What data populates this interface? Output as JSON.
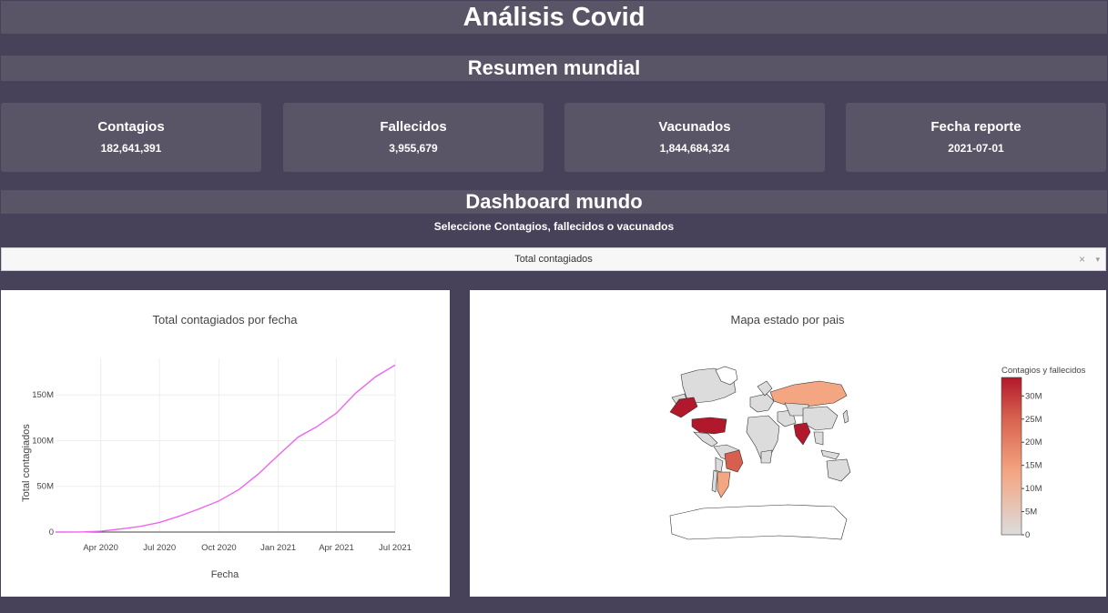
{
  "header": {
    "title": "Análisis Covid",
    "summary_title": "Resumen mundial",
    "dashboard_title": "Dashboard mundo",
    "select_prompt": "Seleccione Contagios, fallecidos o vacunados"
  },
  "cards": [
    {
      "label": "Contagios",
      "value": "182,641,391"
    },
    {
      "label": "Fallecidos",
      "value": "3,955,679"
    },
    {
      "label": "Vacunados",
      "value": "1,844,684,324"
    },
    {
      "label": "Fecha reporte",
      "value": "2021-07-01"
    }
  ],
  "dropdown": {
    "selected": "Total contagiados",
    "clear_icon": "×",
    "arrow_icon": "▾"
  },
  "line_chart": {
    "title": "Total contagiados por fecha",
    "xlabel": "Fecha",
    "ylabel": "Total contagiados",
    "line_color": "#ee66ee"
  },
  "map_chart": {
    "title": "Mapa estado por pais",
    "colorbar_title": "Contagios y fallecidos",
    "colorbar_ticks": [
      "30M",
      "25M",
      "20M",
      "15M",
      "10M",
      "5M",
      "0"
    ],
    "colorscale": [
      "#dcdcdc",
      "#f4a582",
      "#d6604d",
      "#b2182b"
    ]
  },
  "chart_data": [
    {
      "type": "line",
      "title": "Total contagiados por fecha",
      "xlabel": "Fecha",
      "ylabel": "Total contagiados",
      "x": [
        "2020-01-22",
        "2020-03-01",
        "2020-04-01",
        "2020-05-01",
        "2020-06-01",
        "2020-07-01",
        "2020-08-01",
        "2020-09-01",
        "2020-10-01",
        "2020-11-01",
        "2020-12-01",
        "2021-01-01",
        "2021-02-01",
        "2021-03-01",
        "2021-04-01",
        "2021-05-01",
        "2021-06-01",
        "2021-07-01"
      ],
      "series": [
        {
          "values": [
            0.0005,
            0.09,
            0.9,
            3.3,
            6.2,
            10.5,
            17.5,
            25.5,
            34.0,
            46.5,
            63.5,
            84.0,
            104.0,
            115.0,
            130.0,
            152.0,
            170.0,
            182.6
          ]
        }
      ],
      "y_unit": "M",
      "xticks": [
        "Apr 2020",
        "Jul 2020",
        "Oct 2020",
        "Jan 2021",
        "Apr 2021",
        "Jul 2021"
      ],
      "yticks": [
        "0",
        "50M",
        "100M",
        "150M"
      ],
      "ylim": [
        0,
        190
      ],
      "grid": true
    }
  ]
}
